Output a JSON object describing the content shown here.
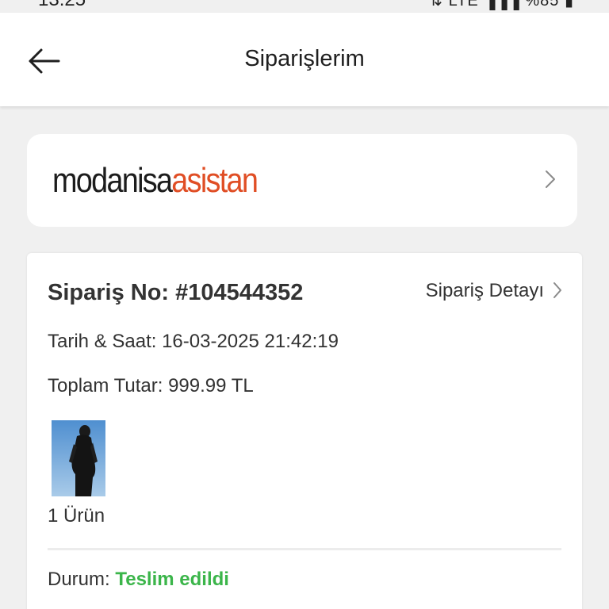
{
  "status_bar": {
    "time": "13:25",
    "indicators": "⇅ LTE ▐▐▐ %85 ▮"
  },
  "header": {
    "back_icon": "arrow-left-icon",
    "title": "Siparişlerim"
  },
  "assistant_banner": {
    "brand_primary": "modanisa",
    "brand_secondary": "asistan",
    "brand_primary_color": "#1c1c1c",
    "brand_secondary_color": "#e04e25",
    "chevron_icon": "chevron-right-icon"
  },
  "order": {
    "number_label": "Sipariş No: #104544352",
    "detail_link": "Sipariş Detayı",
    "date_line": "Tarih & Saat: 16-03-2025 21:42:19",
    "total_line": "Toplam Tutar: 999.99 TL",
    "item_count": "1 Ürün",
    "status_label": "Durum:",
    "status_value": "Teslim edildi",
    "status_color": "#3bb54a"
  }
}
